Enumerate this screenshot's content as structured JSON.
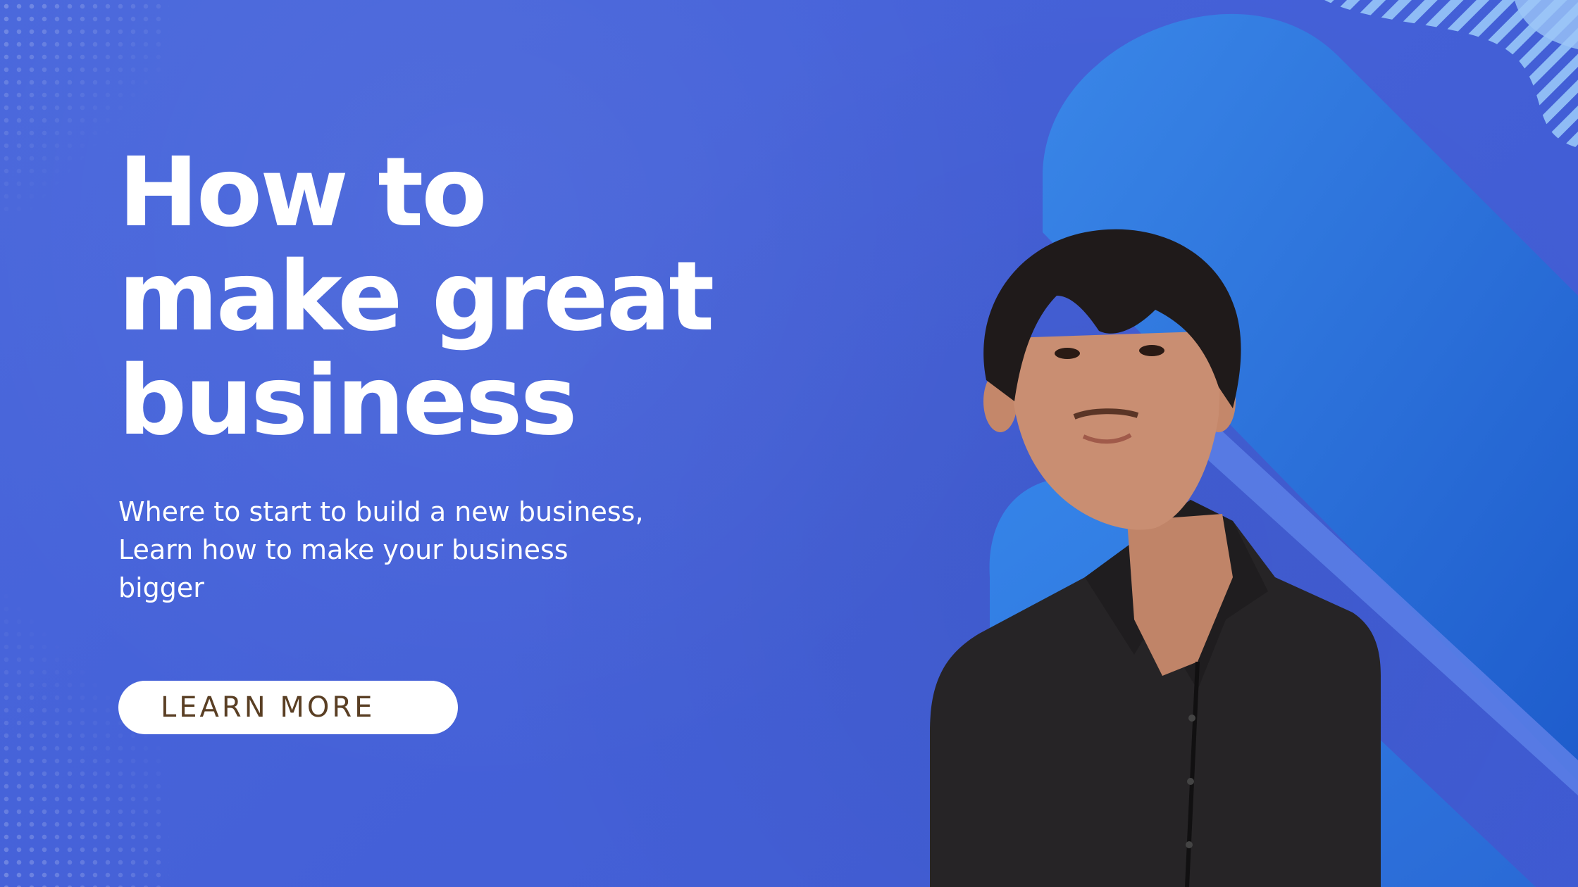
{
  "banner": {
    "headline": [
      "How to",
      "make great",
      "business"
    ],
    "subtext": "Where to start to build a new business, Learn how to make your business bigger",
    "cta_label": "LEARN MORE"
  },
  "colors": {
    "background": "#4563d9",
    "shape_light": "#3a87e8",
    "shape_dark": "#1e5ccc",
    "heading_text": "#ffffff",
    "button_bg": "#ffffff",
    "button_text": "#5a3f24",
    "shirt": "#262426",
    "hair": "#1f1a1a",
    "skin": "#c98e72"
  },
  "icons": {
    "dot_grid_top": "dot-grid-decoration",
    "dot_grid_bottom": "dot-grid-decoration",
    "stripes": "diagonal-stripes-decoration"
  }
}
